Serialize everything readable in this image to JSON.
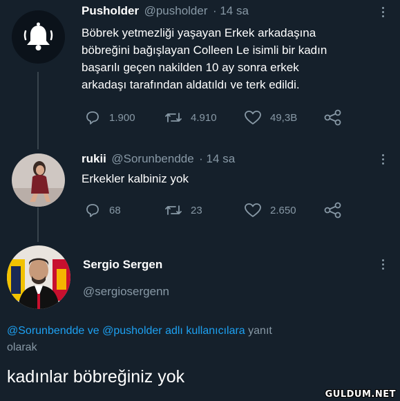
{
  "tweet1": {
    "name": "Pusholder",
    "handle": "@pusholder",
    "time": "· 14 sa",
    "text": [
      "Böbrek yetmezliği yaşayan Erkek arkadaşına",
      "böbreğini bağışlayan Colleen Le isimli bir kadın",
      "başarılı geçen nakilden 10 ay sonra erkek",
      "arkadaşı tarafından aldatıldı ve terk edildi."
    ],
    "replies": "1.900",
    "retweets": "4.910",
    "likes": "49,3B",
    "avatar_icon": "bell-icon"
  },
  "tweet2": {
    "name": "rukii",
    "handle": "@Sorunbendde",
    "time": "· 14 sa",
    "text": "Erkekler kalbiniz yok",
    "replies": "68",
    "retweets": "23",
    "likes": "2.650"
  },
  "tweet3": {
    "name": "Sergio Sergen",
    "handle": "@sergiosergenn",
    "reply_mentions": "@Sorunbendde ve @pusholder adlı kullanıcılara",
    "reply_suffix_1": "yanıt",
    "reply_suffix_2": "olarak",
    "text": "kadınlar böbreğiniz yok"
  },
  "watermark": "GULDUM.NET",
  "colors": {
    "background": "#15202b",
    "accent": "#1da1f2",
    "muted": "#8899a6"
  }
}
